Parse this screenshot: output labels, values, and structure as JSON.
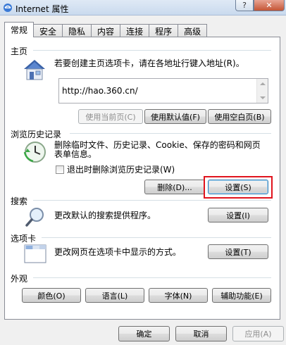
{
  "window": {
    "title": "Internet 属性",
    "help_label": "?",
    "close_label": "✕"
  },
  "tabs": [
    {
      "label": "常规",
      "active": true
    },
    {
      "label": "安全"
    },
    {
      "label": "隐私"
    },
    {
      "label": "内容"
    },
    {
      "label": "连接"
    },
    {
      "label": "程序"
    },
    {
      "label": "高级"
    }
  ],
  "home": {
    "label": "主页",
    "description": "若要创建主页选项卡，请在各地址行键入地址(R)。",
    "address": "http://hao.360.cn/",
    "btn_current": "使用当前页(C)",
    "btn_default": "使用默认值(F)",
    "btn_blank": "使用空白页(B)"
  },
  "history": {
    "label": "浏览历史记录",
    "description_line1": "删除临时文件、历史记录、Cookie、保存的密码和网页",
    "description_line2": "表单信息。",
    "checkbox_label": "退出时删除浏览历史记录(W)",
    "btn_delete": "删除(D)...",
    "btn_settings": "设置(S)"
  },
  "search": {
    "label": "搜索",
    "description": "更改默认的搜索提供程序。",
    "btn_settings": "设置(I)"
  },
  "tabs_section": {
    "label": "选项卡",
    "description": "更改网页在选项卡中显示的方式。",
    "btn_settings": "设置(T)"
  },
  "appearance": {
    "label": "外观",
    "btn_colors": "颜色(O)",
    "btn_languages": "语言(L)",
    "btn_fonts": "字体(N)",
    "btn_accessibility": "辅助功能(E)"
  },
  "footer": {
    "btn_ok": "确定",
    "btn_cancel": "取消",
    "btn_apply": "应用(A)"
  },
  "colors": {
    "highlight": "#e0141e",
    "accent": "#3c7fb1"
  }
}
